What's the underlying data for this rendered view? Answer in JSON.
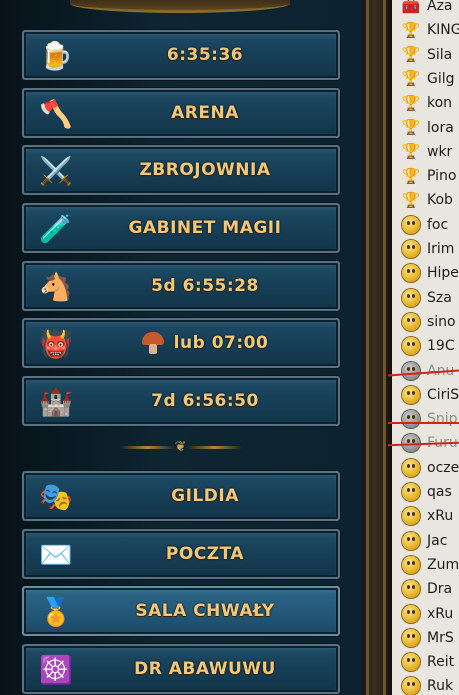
{
  "menu": [
    {
      "id": "tavern",
      "icon": "beer-mug-icon",
      "glyph": "🍺",
      "label": "6:35:36"
    },
    {
      "id": "arena",
      "icon": "arena-fighter-icon",
      "glyph": "🪓",
      "label": "ARENA"
    },
    {
      "id": "armory",
      "icon": "crossed-swords-icon",
      "glyph": "⚔️",
      "label": "ZBROJOWNIA"
    },
    {
      "id": "magic-shop",
      "icon": "magic-potions-icon",
      "glyph": "🧪",
      "label": "GABINET MAGII"
    },
    {
      "id": "stable",
      "icon": "horse-icon",
      "glyph": "🐴",
      "label": "5d 6:55:28"
    },
    {
      "id": "dungeon",
      "icon": "demon-head-icon",
      "glyph": "👹",
      "label": "lub 07:00",
      "prefix_icon": "mushroom-icon"
    },
    {
      "id": "tower",
      "icon": "castle-gate-icon",
      "glyph": "🏰",
      "label": "7d 6:56:50"
    },
    {
      "id": "guild",
      "icon": "golden-mask-icon",
      "glyph": "🎭",
      "label": "GILDIA"
    },
    {
      "id": "mail",
      "icon": "envelope-icon",
      "glyph": "✉️",
      "label": "POCZTA"
    },
    {
      "id": "hall-of-fame",
      "icon": "laurel-wreath-icon",
      "glyph": "🏅",
      "label": "SALA CHWAŁY"
    },
    {
      "id": "dr-abawuwu",
      "icon": "wooden-wheel-icon",
      "glyph": "☸️",
      "label": "DR ABAWUWU"
    }
  ],
  "players": [
    {
      "name": "Aza",
      "icon": "guild-chest-icon",
      "glyph": "🧰",
      "status": "online"
    },
    {
      "name": "KING",
      "icon": "rank-figure-icon",
      "glyph": "🏆",
      "status": "online"
    },
    {
      "name": "Sila",
      "icon": "rank-figure-icon",
      "glyph": "🏆",
      "status": "online"
    },
    {
      "name": "Gilg",
      "icon": "rank-figure-icon",
      "glyph": "🏆",
      "status": "online"
    },
    {
      "name": "kon",
      "icon": "rank-figure-icon",
      "glyph": "🏆",
      "status": "online"
    },
    {
      "name": "lora",
      "icon": "rank-figure-icon",
      "glyph": "🏆",
      "status": "online"
    },
    {
      "name": "wkr",
      "icon": "rank-figure-icon",
      "glyph": "🏆",
      "status": "online"
    },
    {
      "name": "Pino",
      "icon": "rank-figure-icon",
      "glyph": "🏆",
      "status": "online"
    },
    {
      "name": "Kob",
      "icon": "rank-figure-icon",
      "glyph": "🏆",
      "status": "online"
    },
    {
      "name": "foc",
      "icon": "smiley-icon",
      "status": "online"
    },
    {
      "name": "Irim",
      "icon": "smiley-icon",
      "status": "online"
    },
    {
      "name": "Hipe",
      "icon": "smiley-icon",
      "status": "online"
    },
    {
      "name": "Sza",
      "icon": "smiley-icon",
      "status": "online"
    },
    {
      "name": "sino",
      "icon": "smiley-icon",
      "status": "online"
    },
    {
      "name": "19C",
      "icon": "smiley-icon",
      "status": "online"
    },
    {
      "name": "Anu",
      "icon": "smiley-icon",
      "status": "offline"
    },
    {
      "name": "CiriS",
      "icon": "smiley-icon",
      "status": "online"
    },
    {
      "name": "Snip",
      "icon": "smiley-icon",
      "status": "offline"
    },
    {
      "name": "Furu",
      "icon": "smiley-icon",
      "status": "offline"
    },
    {
      "name": "ocze",
      "icon": "smiley-icon",
      "status": "online"
    },
    {
      "name": "qas",
      "icon": "smiley-icon",
      "status": "online"
    },
    {
      "name": "xRu",
      "icon": "smiley-icon",
      "status": "online"
    },
    {
      "name": "Jac",
      "icon": "smiley-icon",
      "status": "online"
    },
    {
      "name": "Zum",
      "icon": "smiley-icon",
      "status": "online"
    },
    {
      "name": "Dra",
      "icon": "smiley-icon",
      "status": "online"
    },
    {
      "name": "xRu",
      "icon": "smiley-icon",
      "status": "online"
    },
    {
      "name": "MrS",
      "icon": "smiley-icon",
      "status": "online"
    },
    {
      "name": "Reit",
      "icon": "smiley-icon",
      "status": "online"
    },
    {
      "name": "Ruk",
      "icon": "smiley-icon",
      "status": "online"
    }
  ],
  "colors": {
    "label_gold": "#f2c777",
    "panel_blue": "#174058",
    "annotation_red": "#d1221d"
  }
}
